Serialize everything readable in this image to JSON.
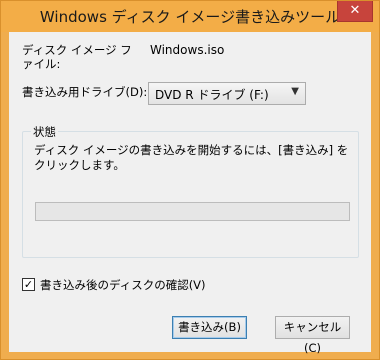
{
  "window": {
    "title": "Windows ディスク イメージ書き込みツール",
    "close_glyph": "✕"
  },
  "file": {
    "label": "ディスク イメージ ファイル:",
    "value": "Windows.iso"
  },
  "drive": {
    "label": "書き込み用ドライブ(D):",
    "selected": "DVD R ドライブ (F:)",
    "arrow_glyph": "▼"
  },
  "status": {
    "group_title": "状態",
    "text": "ディスク イメージの書き込みを開始するには、[書き込み] をクリックします。",
    "progress": 0
  },
  "verify": {
    "label": "書き込み後のディスクの確認(V)",
    "checked": true,
    "check_glyph": "✓"
  },
  "buttons": {
    "write": "書き込み(B)",
    "cancel": "キャンセル(C)"
  },
  "colors": {
    "title_bar": "#f3ad47",
    "close_button": "#c7443c",
    "client": "#f0f0f0"
  }
}
